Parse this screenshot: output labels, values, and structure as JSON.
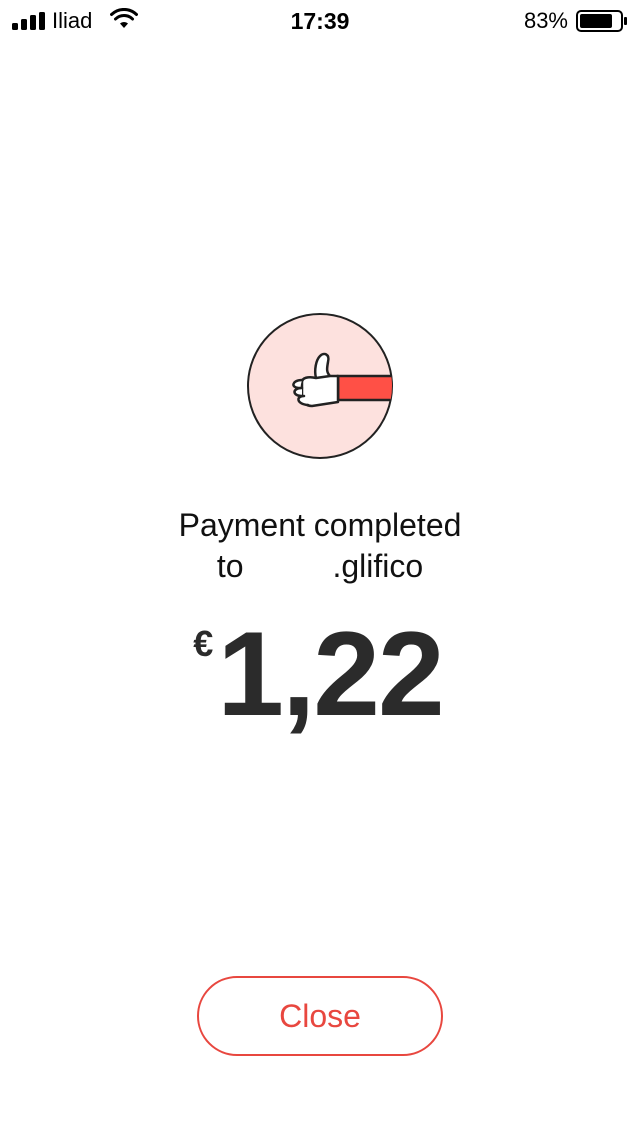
{
  "status_bar": {
    "carrier": "Iliad",
    "time": "17:39",
    "battery_percent": "83%",
    "battery_level": 0.83,
    "signal_bars_filled": 4,
    "icons": [
      "signal-icon",
      "wifi-icon",
      "battery-icon"
    ]
  },
  "illustration": {
    "icon": "thumbs-up-icon",
    "circle_color": "#fde1de",
    "sleeve_color": "#ff5046"
  },
  "message": {
    "line1": "Payment completed",
    "line2": "to          .glifico"
  },
  "amount": {
    "currency": "€",
    "value": "1,22"
  },
  "actions": {
    "close_label": "Close",
    "accent_color": "#e8473f"
  }
}
